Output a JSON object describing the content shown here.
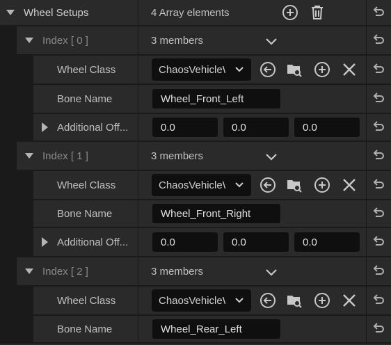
{
  "wheel_setups": {
    "label": "Wheel Setups",
    "summary": "4 Array elements"
  },
  "elements": [
    {
      "index_label": "Index [ 0 ]",
      "members": "3 members",
      "wheel_class_label": "Wheel Class",
      "wheel_class_value": "ChaosVehicleWheel",
      "bone_name_label": "Bone Name",
      "bone_name_value": "Wheel_Front_Left",
      "offset_label": "Additional Off...",
      "offset": [
        "0.0",
        "0.0",
        "0.0"
      ]
    },
    {
      "index_label": "Index [ 1 ]",
      "members": "3 members",
      "wheel_class_label": "Wheel Class",
      "wheel_class_value": "ChaosVehicleWheel",
      "bone_name_label": "Bone Name",
      "bone_name_value": "Wheel_Front_Right",
      "offset_label": "Additional Off...",
      "offset": [
        "0.0",
        "0.0",
        "0.0"
      ]
    },
    {
      "index_label": "Index [ 2 ]",
      "members": "3 members",
      "wheel_class_label": "Wheel Class",
      "wheel_class_value": "ChaosVehicleWheel",
      "bone_name_label": "Bone Name",
      "bone_name_value": "Wheel_Rear_Left"
    }
  ],
  "icons": {
    "add": "plus-circle-icon",
    "delete": "trash-icon",
    "reset": "reset-arrow-icon",
    "use_selected": "use-selected-arrow-icon",
    "browse": "browse-folder-icon",
    "clear": "clear-x-icon",
    "dropdown": "chevron-down-icon"
  },
  "colors": {
    "panel_bg": "#1a1a1a",
    "row_bg": "#2a2a2a",
    "field_bg": "#0f0f0f",
    "text": "#c0c0c0",
    "dim_text": "#8a8a8a"
  }
}
